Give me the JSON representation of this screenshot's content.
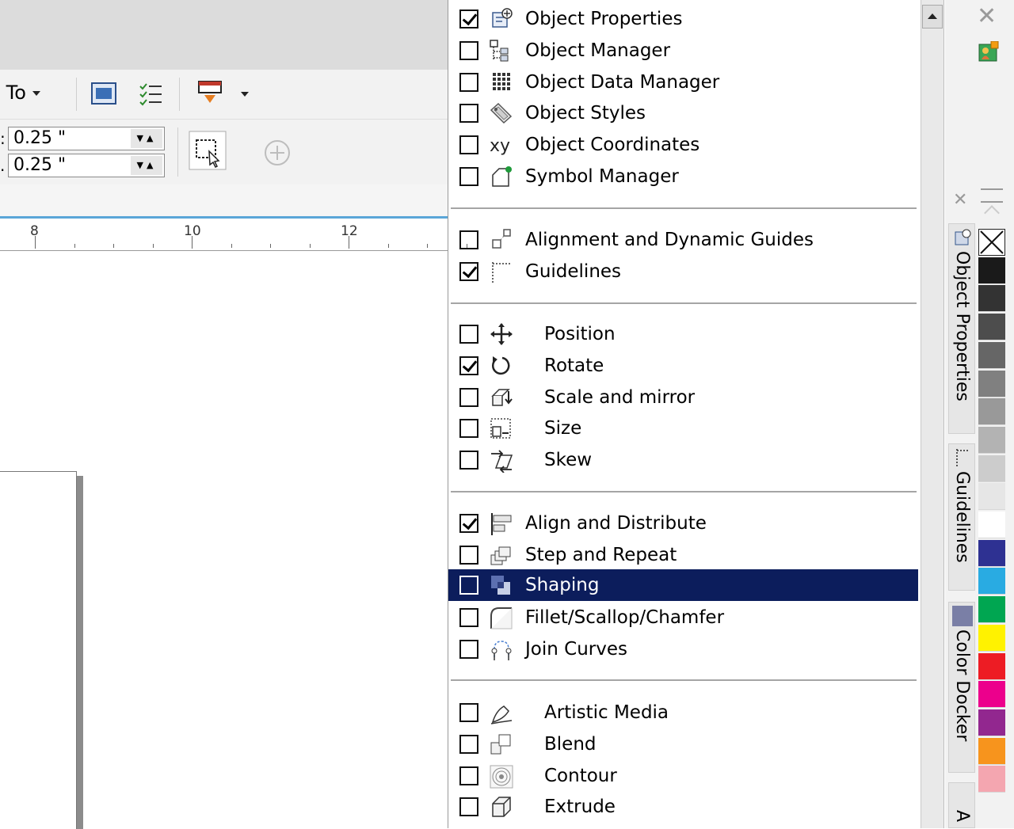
{
  "toolbar": {
    "snap_to_label": " To",
    "nudge_label_1": ":",
    "nudge_value_1": "0.25 \"",
    "nudge_label_2": ".",
    "nudge_value_2": "0.25 \""
  },
  "ruler": {
    "ticks": [
      "8",
      "10",
      "12"
    ]
  },
  "menu": {
    "groups": [
      [
        {
          "label": "Object Properties",
          "checked": true,
          "icon": "object-properties-icon"
        },
        {
          "label": "Object Manager",
          "checked": false,
          "icon": "object-manager-icon"
        },
        {
          "label": "Object Data Manager",
          "checked": false,
          "icon": "object-data-manager-icon"
        },
        {
          "label": "Object Styles",
          "checked": false,
          "icon": "object-styles-icon"
        },
        {
          "label": "Object Coordinates",
          "checked": false,
          "icon": "object-coordinates-icon"
        },
        {
          "label": "Symbol Manager",
          "checked": false,
          "icon": "symbol-manager-icon"
        }
      ],
      [
        {
          "label": "Alignment and Dynamic Guides",
          "checked": false,
          "icon": "dynamic-guides-icon"
        },
        {
          "label": "Guidelines",
          "checked": true,
          "icon": "guidelines-icon"
        }
      ],
      [
        {
          "label": "Position",
          "checked": false,
          "icon": "position-icon"
        },
        {
          "label": "Rotate",
          "checked": true,
          "icon": "rotate-icon"
        },
        {
          "label": "Scale and mirror",
          "checked": false,
          "icon": "scale-mirror-icon"
        },
        {
          "label": "Size",
          "checked": false,
          "icon": "size-icon"
        },
        {
          "label": "Skew",
          "checked": false,
          "icon": "skew-icon"
        }
      ],
      [
        {
          "label": "Align and Distribute",
          "checked": true,
          "icon": "align-distribute-icon"
        },
        {
          "label": "Step and Repeat",
          "checked": false,
          "icon": "step-repeat-icon"
        },
        {
          "label": "Shaping",
          "checked": false,
          "icon": "shaping-icon",
          "highlighted": true
        },
        {
          "label": "Fillet/Scallop/Chamfer",
          "checked": false,
          "icon": "fillet-icon"
        },
        {
          "label": "Join Curves",
          "checked": false,
          "icon": "join-curves-icon"
        }
      ],
      [
        {
          "label": "Artistic Media",
          "checked": false,
          "icon": "artistic-media-icon"
        },
        {
          "label": "Blend",
          "checked": false,
          "icon": "blend-icon"
        },
        {
          "label": "Contour",
          "checked": false,
          "icon": "contour-icon"
        },
        {
          "label": "Extrude",
          "checked": false,
          "icon": "extrude-icon"
        }
      ]
    ]
  },
  "dock": {
    "tabs": [
      "Object Properties",
      "Guidelines",
      "Color Docker",
      "A"
    ],
    "palette": [
      "none",
      "#1a1a1a",
      "#333333",
      "#4d4d4d",
      "#666666",
      "#808080",
      "#999999",
      "#b3b3b3",
      "#cccccc",
      "#e6e6e6",
      "#ffffff",
      "#2e3192",
      "#29abe2",
      "#00a651",
      "#fff200",
      "#ed1c24",
      "#ec008c",
      "#92278f",
      "#f7941d",
      "#f4a6b0"
    ],
    "accent_color": "#0c1d5c"
  }
}
